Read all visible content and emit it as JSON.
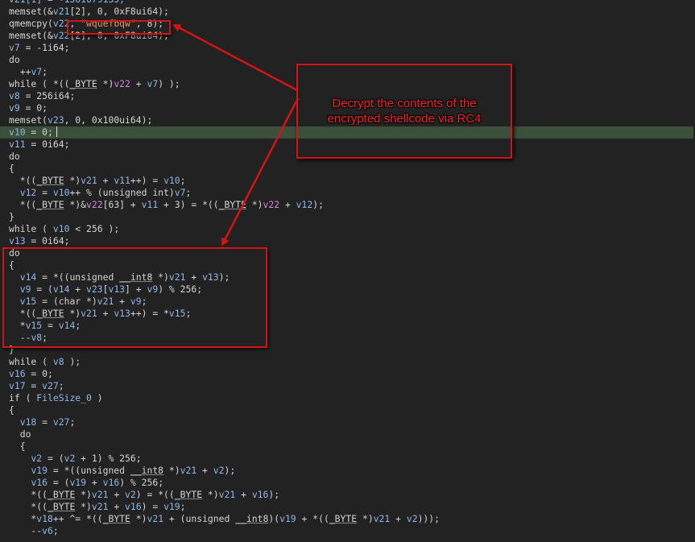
{
  "code_lines": [
    [
      [
        "v21[1] = -1361679135;",
        "t-v"
      ]
    ],
    [
      [
        "memset(&",
        "t-k"
      ],
      [
        "v21",
        "t-v"
      ],
      [
        "[2], 0, 0xF8ui64);",
        "t-k"
      ]
    ],
    [
      [
        "qmemcpy(",
        "t-k"
      ],
      [
        "v22",
        "t-v"
      ],
      [
        ", ",
        "t-k"
      ],
      [
        "\"wquefbqw\"",
        "t-s"
      ],
      [
        ", 8);",
        "t-k"
      ]
    ],
    [
      [
        "memset(&",
        "t-k"
      ],
      [
        "v22",
        "t-v"
      ],
      [
        "[2], 0, 0xF8ui64);",
        "t-k"
      ]
    ],
    [
      [
        "v7",
        "t-v"
      ],
      [
        " = -1i64;",
        "t-k"
      ]
    ],
    [
      [
        "do",
        "t-k"
      ]
    ],
    [
      [
        "  ++",
        "t-k"
      ],
      [
        "v7",
        "t-v"
      ],
      [
        ";",
        "t-k"
      ]
    ],
    [
      [
        "while ( *((",
        "t-k"
      ],
      [
        "_BYTE",
        "t-u"
      ],
      [
        " *)",
        "t-k"
      ],
      [
        "v22",
        "t-m"
      ],
      [
        " + ",
        "t-k"
      ],
      [
        "v7",
        "t-v"
      ],
      [
        ") );",
        "t-k"
      ]
    ],
    [
      [
        "v8",
        "t-v"
      ],
      [
        " = 256i64;",
        "t-k"
      ]
    ],
    [
      [
        "v9",
        "t-v"
      ],
      [
        " = 0;",
        "t-k"
      ]
    ],
    [
      [
        "memset(",
        "t-k"
      ],
      [
        "v23",
        "t-v"
      ],
      [
        ", 0, 0x100ui64);",
        "t-k"
      ]
    ],
    [
      [
        "v10",
        "t-v"
      ],
      [
        " = 0;",
        "t-k"
      ]
    ],
    [
      [
        "v11",
        "t-v"
      ],
      [
        " = 0i64;",
        "t-k"
      ]
    ],
    [
      [
        "do",
        "t-k"
      ]
    ],
    [
      [
        "{",
        "t-k"
      ]
    ],
    [
      [
        "  *((",
        "t-k"
      ],
      [
        "_BYTE",
        "t-u"
      ],
      [
        " *)",
        "t-k"
      ],
      [
        "v21",
        "t-v"
      ],
      [
        " + ",
        "t-k"
      ],
      [
        "v11",
        "t-v"
      ],
      [
        "++) = ",
        "t-k"
      ],
      [
        "v10",
        "t-v"
      ],
      [
        ";",
        "t-k"
      ]
    ],
    [
      [
        "  ",
        "t-k"
      ],
      [
        "v12",
        "t-v"
      ],
      [
        " = ",
        "t-k"
      ],
      [
        "v10",
        "t-v"
      ],
      [
        "++ % (unsigned int)",
        "t-k"
      ],
      [
        "v7",
        "t-v"
      ],
      [
        ";",
        "t-k"
      ]
    ],
    [
      [
        "  *((",
        "t-k"
      ],
      [
        "_BYTE",
        "t-u"
      ],
      [
        " *)&",
        "t-k"
      ],
      [
        "v22",
        "t-m"
      ],
      [
        "[63] + ",
        "t-k"
      ],
      [
        "v11",
        "t-v"
      ],
      [
        " + 3) = *((",
        "t-k"
      ],
      [
        "_BYTE",
        "t-u"
      ],
      [
        " *)",
        "t-k"
      ],
      [
        "v22",
        "t-m"
      ],
      [
        " + ",
        "t-k"
      ],
      [
        "v12",
        "t-v"
      ],
      [
        ");",
        "t-k"
      ]
    ],
    [
      [
        "}",
        "t-k"
      ]
    ],
    [
      [
        "while ( ",
        "t-k"
      ],
      [
        "v10",
        "t-v"
      ],
      [
        " < 256 );",
        "t-k"
      ]
    ],
    [
      [
        "v13",
        "t-v"
      ],
      [
        " = 0i64;",
        "t-k"
      ]
    ],
    [
      [
        "do",
        "t-k"
      ]
    ],
    [
      [
        "{",
        "t-k"
      ]
    ],
    [
      [
        "  ",
        "t-k"
      ],
      [
        "v14",
        "t-v"
      ],
      [
        " = *((unsigned ",
        "t-k"
      ],
      [
        "__int8",
        "t-u"
      ],
      [
        " *)",
        "t-k"
      ],
      [
        "v21",
        "t-v"
      ],
      [
        " + ",
        "t-k"
      ],
      [
        "v13",
        "t-v"
      ],
      [
        ");",
        "t-k"
      ]
    ],
    [
      [
        "  ",
        "t-k"
      ],
      [
        "v9",
        "t-v"
      ],
      [
        " = (",
        "t-k"
      ],
      [
        "v14",
        "t-v"
      ],
      [
        " + ",
        "t-k"
      ],
      [
        "v23",
        "t-v"
      ],
      [
        "[",
        "t-k"
      ],
      [
        "v13",
        "t-v"
      ],
      [
        "] + ",
        "t-k"
      ],
      [
        "v9",
        "t-v"
      ],
      [
        ") % 256;",
        "t-k"
      ]
    ],
    [
      [
        "  ",
        "t-k"
      ],
      [
        "v15",
        "t-v"
      ],
      [
        " = (char *)",
        "t-k"
      ],
      [
        "v21",
        "t-v"
      ],
      [
        " + ",
        "t-k"
      ],
      [
        "v9",
        "t-v"
      ],
      [
        ";",
        "t-k"
      ]
    ],
    [
      [
        "  *((",
        "t-k"
      ],
      [
        "_BYTE",
        "t-u"
      ],
      [
        " *)",
        "t-k"
      ],
      [
        "v21",
        "t-v"
      ],
      [
        " + ",
        "t-k"
      ],
      [
        "v13",
        "t-v"
      ],
      [
        "++) = *",
        "t-k"
      ],
      [
        "v15",
        "t-v"
      ],
      [
        ";",
        "t-k"
      ]
    ],
    [
      [
        "  *",
        "t-k"
      ],
      [
        "v15",
        "t-v"
      ],
      [
        " = ",
        "t-k"
      ],
      [
        "v14",
        "t-v"
      ],
      [
        ";",
        "t-k"
      ]
    ],
    [
      [
        "  --",
        "t-k"
      ],
      [
        "v8",
        "t-v"
      ],
      [
        ";",
        "t-k"
      ]
    ],
    [
      [
        "}",
        "t-k"
      ]
    ],
    [
      [
        "while ( ",
        "t-k"
      ],
      [
        "v8",
        "t-v"
      ],
      [
        " );",
        "t-k"
      ]
    ],
    [
      [
        "v16",
        "t-v"
      ],
      [
        " = 0;",
        "t-k"
      ]
    ],
    [
      [
        "v17",
        "t-v"
      ],
      [
        " = ",
        "t-k"
      ],
      [
        "v27",
        "t-v"
      ],
      [
        ";",
        "t-k"
      ]
    ],
    [
      [
        "if ( ",
        "t-k"
      ],
      [
        "FileSize_0",
        "t-v"
      ],
      [
        " )",
        "t-k"
      ]
    ],
    [
      [
        "{",
        "t-k"
      ]
    ],
    [
      [
        "  ",
        "t-k"
      ],
      [
        "v18",
        "t-v"
      ],
      [
        " = ",
        "t-k"
      ],
      [
        "v27",
        "t-v"
      ],
      [
        ";",
        "t-k"
      ]
    ],
    [
      [
        "  do",
        "t-k"
      ]
    ],
    [
      [
        "  {",
        "t-k"
      ]
    ],
    [
      [
        "    ",
        "t-k"
      ],
      [
        "v2",
        "t-v"
      ],
      [
        " = (",
        "t-k"
      ],
      [
        "v2",
        "t-v"
      ],
      [
        " + 1) % 256;",
        "t-k"
      ]
    ],
    [
      [
        "    ",
        "t-k"
      ],
      [
        "v19",
        "t-v"
      ],
      [
        " = *((unsigned ",
        "t-k"
      ],
      [
        "__int8",
        "t-u"
      ],
      [
        " *)",
        "t-k"
      ],
      [
        "v21",
        "t-v"
      ],
      [
        " + ",
        "t-k"
      ],
      [
        "v2",
        "t-v"
      ],
      [
        ");",
        "t-k"
      ]
    ],
    [
      [
        "    ",
        "t-k"
      ],
      [
        "v16",
        "t-v"
      ],
      [
        " = (",
        "t-k"
      ],
      [
        "v19",
        "t-v"
      ],
      [
        " + ",
        "t-k"
      ],
      [
        "v16",
        "t-v"
      ],
      [
        ") % 256;",
        "t-k"
      ]
    ],
    [
      [
        "    *((",
        "t-k"
      ],
      [
        "_BYTE",
        "t-u"
      ],
      [
        " *)",
        "t-k"
      ],
      [
        "v21",
        "t-v"
      ],
      [
        " + ",
        "t-k"
      ],
      [
        "v2",
        "t-v"
      ],
      [
        ") = *((",
        "t-k"
      ],
      [
        "_BYTE",
        "t-u"
      ],
      [
        " *)",
        "t-k"
      ],
      [
        "v21",
        "t-v"
      ],
      [
        " + ",
        "t-k"
      ],
      [
        "v16",
        "t-v"
      ],
      [
        ");",
        "t-k"
      ]
    ],
    [
      [
        "    *((",
        "t-k"
      ],
      [
        "_BYTE",
        "t-u"
      ],
      [
        " *)",
        "t-k"
      ],
      [
        "v21",
        "t-v"
      ],
      [
        " + ",
        "t-k"
      ],
      [
        "v16",
        "t-v"
      ],
      [
        ") = ",
        "t-k"
      ],
      [
        "v19",
        "t-v"
      ],
      [
        ";",
        "t-k"
      ]
    ],
    [
      [
        "    *",
        "t-k"
      ],
      [
        "v18",
        "t-v"
      ],
      [
        "++ ^= *((",
        "t-k"
      ],
      [
        "_BYTE",
        "t-u"
      ],
      [
        " *)",
        "t-k"
      ],
      [
        "v21",
        "t-v"
      ],
      [
        " + (unsigned ",
        "t-k"
      ],
      [
        "__int8",
        "t-u"
      ],
      [
        ")(",
        "t-k"
      ],
      [
        "v19",
        "t-v"
      ],
      [
        " + *((",
        "t-k"
      ],
      [
        "_BYTE",
        "t-u"
      ],
      [
        " *)",
        "t-k"
      ],
      [
        "v21",
        "t-v"
      ],
      [
        " + ",
        "t-k"
      ],
      [
        "v2",
        "t-v"
      ],
      [
        ")));",
        "t-k"
      ]
    ],
    [
      [
        "    --",
        "t-k"
      ],
      [
        "v6",
        "t-v"
      ],
      [
        ";",
        "t-k"
      ]
    ]
  ],
  "highlighted_line_index": 11,
  "callout": {
    "text": "Decrypt the contents of the encrypted shellcode via RC4"
  },
  "colors": {
    "background": "#222222",
    "highlight_line": "#3b4f3b",
    "annotation_red": "#d31414",
    "string_literal": "#e8934e",
    "variable": "#8fb8e8"
  }
}
